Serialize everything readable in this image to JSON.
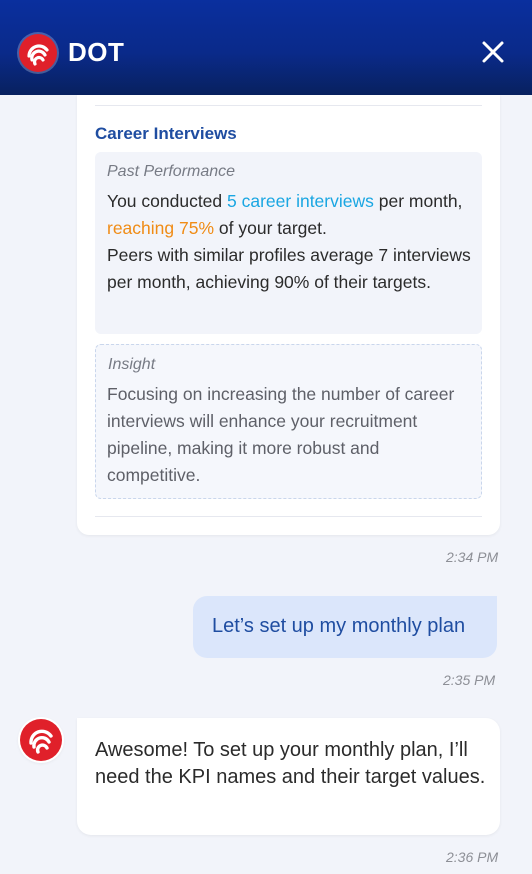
{
  "header": {
    "title": "DOT",
    "logo_icon": "dot-logo-icon",
    "close_icon": "close-icon",
    "colors": {
      "top": "#0a2f9e",
      "bottom": "#08215f",
      "logo": "#e0202a"
    }
  },
  "insight_card": {
    "section_title": "Career Interviews",
    "past_performance": {
      "label": "Past Performance",
      "line1_prefix": "You conducted ",
      "line1_highlight": "5 career interviews",
      "line1_mid": " per month, ",
      "line1_highlight2": "reaching 75%",
      "line1_suffix": " of your target.",
      "line2": "Peers with similar profiles average 7 interviews per month, achieving 90% of their targets."
    },
    "insight": {
      "label": "Insight",
      "text": "Focusing on increasing the number of career interviews will enhance your recruitment pipeline, making it more robust and competitive."
    },
    "timestamp": "2:34 PM"
  },
  "messages": [
    {
      "role": "user",
      "text": "Let’s set up my monthly plan",
      "timestamp": "2:35 PM"
    },
    {
      "role": "bot",
      "text": "Awesome! To set up your monthly plan, I’ll need the KPI names and their target values.",
      "timestamp": "2:36 PM"
    }
  ],
  "colors": {
    "accent_blue": "#1aa6e2",
    "accent_orange": "#f08c16",
    "title_blue": "#1f4da1",
    "user_bubble": "#dbe6fb",
    "background": "#f2f4fa"
  }
}
